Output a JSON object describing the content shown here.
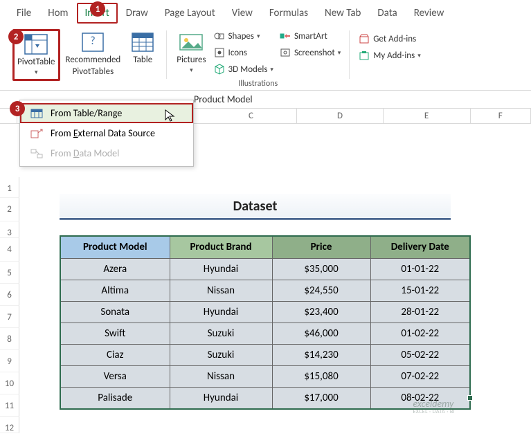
{
  "tabs": {
    "file": "File",
    "home": "Hom",
    "insert": "Insert",
    "draw": "Draw",
    "pagelayout": "Page Layout",
    "view": "View",
    "formulas": "Formulas",
    "newtab": "New Tab",
    "data": "Data",
    "review": "Review"
  },
  "ribbon": {
    "pivot_btn": "PivotTable",
    "recommended_l1": "Recommended",
    "recommended_l2": "PivotTables",
    "table_btn": "Table",
    "pictures_btn": "Pictures",
    "shapes": "Shapes",
    "icons": "Icons",
    "models": "3D Models",
    "illustrations_label": "Illustrations",
    "smartart": "SmartArt",
    "screenshot": "Screenshot",
    "getaddins": "Get Add-ins",
    "myaddins": "My Add-ins"
  },
  "dropdown": {
    "from_table": "From Table/Range",
    "from_ext_pre": "From ",
    "from_ext_u": "E",
    "from_ext_post": "xternal Data Source",
    "from_dm_pre": "From ",
    "from_dm_u": "D",
    "from_dm_post": "ata Model"
  },
  "formula_bar": "Product Model",
  "cols": {
    "c": "C",
    "d": "D",
    "e": "E",
    "f": "F"
  },
  "rownums": [
    "1",
    "2",
    "3",
    "4",
    "5",
    "6",
    "7",
    "8",
    "9",
    "10",
    "11",
    "12"
  ],
  "dataset_title": "Dataset",
  "headers": {
    "model": "Product Model",
    "brand": "Product Brand",
    "price": "Price",
    "date": "Delivery Date"
  },
  "rowsdata": [
    {
      "model": "Azera",
      "brand": "Hyundai",
      "price": "$35,000",
      "date": "01-01-22"
    },
    {
      "model": "Altima",
      "brand": "Nissan",
      "price": "$24,550",
      "date": "15-01-22"
    },
    {
      "model": "Sonata",
      "brand": "Hyundai",
      "price": "$23,400",
      "date": "28-01-22"
    },
    {
      "model": "Swift",
      "brand": "Suzuki",
      "price": "$46,000",
      "date": "01-02-22"
    },
    {
      "model": "Ciaz",
      "brand": "Suzuki",
      "price": "$14,230",
      "date": "05-02-22"
    },
    {
      "model": "Versa",
      "brand": "Nissan",
      "price": "$15,080",
      "date": "07-02-22"
    },
    {
      "model": "Palisade",
      "brand": "Hyundai",
      "price": "$17,000",
      "date": "08-02-22"
    }
  ],
  "badges": {
    "b1": "1",
    "b2": "2",
    "b3": "3"
  },
  "watermark": {
    "brand": "exceldemy",
    "tag": "EXCEL · DATA · BI"
  }
}
